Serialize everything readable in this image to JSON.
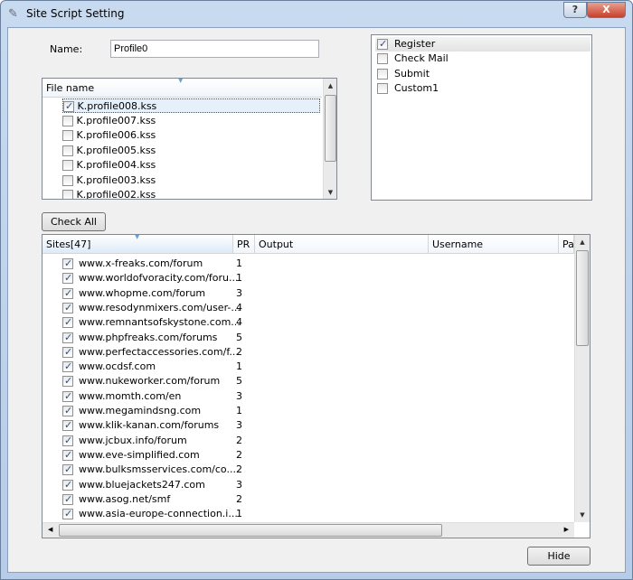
{
  "window": {
    "title": "Site Script Setting",
    "help": "?",
    "close": "X"
  },
  "name": {
    "label": "Name:",
    "value": "Profile0"
  },
  "files": {
    "header": "File name",
    "items": [
      {
        "name": "K.profile008.kss",
        "checked": true
      },
      {
        "name": "K.profile007.kss",
        "checked": false
      },
      {
        "name": "K.profile006.kss",
        "checked": false
      },
      {
        "name": "K.profile005.kss",
        "checked": false
      },
      {
        "name": "K.profile004.kss",
        "checked": false
      },
      {
        "name": "K.profile003.kss",
        "checked": false
      },
      {
        "name": "K.profile002.kss",
        "checked": false
      }
    ]
  },
  "actions": [
    {
      "label": "Register",
      "checked": true
    },
    {
      "label": "Check Mail",
      "checked": false
    },
    {
      "label": "Submit",
      "checked": false
    },
    {
      "label": "Custom1",
      "checked": false
    }
  ],
  "check_all": "Check All",
  "sites": {
    "columns": [
      "Sites[47]",
      "PR",
      "Output",
      "Username",
      "Pa"
    ],
    "rows": [
      {
        "site": "www.x-freaks.com/forum",
        "pr": "1"
      },
      {
        "site": "www.worldofvoracity.com/foru...",
        "pr": "1"
      },
      {
        "site": "www.whopme.com/forum",
        "pr": "3"
      },
      {
        "site": "www.resodynmixers.com/user-...",
        "pr": "4"
      },
      {
        "site": "www.remnantsofskystone.com...",
        "pr": "4"
      },
      {
        "site": "www.phpfreaks.com/forums",
        "pr": "5"
      },
      {
        "site": "www.perfectaccessories.com/f...",
        "pr": "2"
      },
      {
        "site": "www.ocdsf.com",
        "pr": "1"
      },
      {
        "site": "www.nukeworker.com/forum",
        "pr": "5"
      },
      {
        "site": "www.momth.com/en",
        "pr": "3"
      },
      {
        "site": "www.megamindsng.com",
        "pr": "1"
      },
      {
        "site": "www.klik-kanan.com/forums",
        "pr": "3"
      },
      {
        "site": "www.jcbux.info/forum",
        "pr": "2"
      },
      {
        "site": "www.eve-simplified.com",
        "pr": "2"
      },
      {
        "site": "www.bulksmsservices.com/co...",
        "pr": "2"
      },
      {
        "site": "www.bluejackets247.com",
        "pr": "3"
      },
      {
        "site": "www.asog.net/smf",
        "pr": "2"
      },
      {
        "site": "www.asia-europe-connection.i...",
        "pr": "1"
      }
    ]
  },
  "hide": "Hide"
}
